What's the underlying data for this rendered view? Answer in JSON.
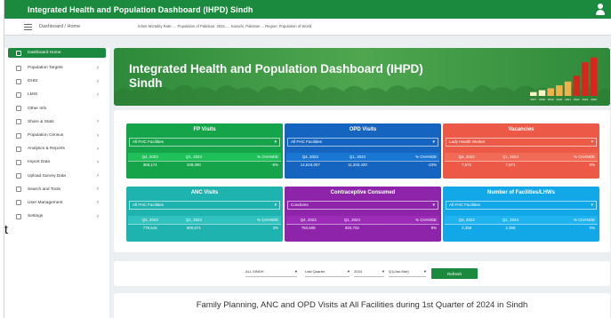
{
  "topbar": {
    "title": "Integrated Health and Population Dashboard (IHPD) Sindh",
    "user_icon": "user-icon"
  },
  "subbar": {
    "breadcrumb": "Dashboard / Home",
    "ticker": "Infant Mortality Rate: ... Population of Pakistan: 2024, ... Karachi, Pakistan ... Region: Population of World"
  },
  "sidebar": {
    "items": [
      {
        "label": "Dashboard Home",
        "icon": "home-icon",
        "caret": ""
      },
      {
        "label": "Population Targets",
        "icon": "target-icon",
        "caret": "›"
      },
      {
        "label": "DHIS",
        "icon": "gear-icon",
        "caret": "›"
      },
      {
        "label": "LMIS",
        "icon": "gear-icon",
        "caret": "›"
      },
      {
        "label": "Other Info",
        "icon": "gear-icon",
        "caret": ""
      },
      {
        "label": "Share & Stats",
        "icon": "gear-icon",
        "caret": "›"
      },
      {
        "label": "Population Census",
        "icon": "gear-icon",
        "caret": "›"
      },
      {
        "label": "Analytics & Reports",
        "icon": "gear-icon",
        "caret": "›"
      },
      {
        "label": "Import Data",
        "icon": "upload-icon",
        "caret": "›"
      },
      {
        "label": "Upload Survey Data",
        "icon": "upload-icon",
        "caret": "›"
      },
      {
        "label": "Search and Tools",
        "icon": "upload-icon",
        "caret": "›"
      },
      {
        "label": "User Management",
        "icon": "users-icon",
        "caret": "›"
      },
      {
        "label": "Settings",
        "icon": "gear-icon",
        "caret": "›"
      }
    ],
    "stray_char": "t"
  },
  "banner": {
    "title": "Integrated Health and Population Dashboard (IHPD) Sindh",
    "mini_chart": {
      "type": "bar",
      "categories": [
        "2017",
        "2018",
        "2019",
        "2020",
        "2021",
        "2022",
        "2023",
        "2024"
      ],
      "values": [
        8,
        12,
        16,
        22,
        30,
        42,
        70,
        80
      ],
      "value_labels": [
        "",
        "",
        "",
        "",
        "",
        "",
        "",
        ""
      ]
    }
  },
  "cards": [
    {
      "title": "FP Visits",
      "color": "#16a44a",
      "header_color": "#1fbf5a",
      "select": "All FHC Facilities",
      "cols": [
        "Q4, 2023",
        "Q1, 2024",
        "% CHANGE"
      ],
      "vals": [
        "369,174",
        "349,390",
        "-5%"
      ]
    },
    {
      "title": "OPD Visits",
      "color": "#1564c0",
      "header_color": "#1976d2",
      "select": "All FHC Facilities",
      "cols": [
        "Q4, 2023",
        "Q1, 2024",
        "% CHANGE"
      ],
      "vals": [
        "14,619,007",
        "11,203,420",
        "-23%"
      ]
    },
    {
      "title": "Vacancies",
      "color": "#ec5a47",
      "header_color": "#f06a55",
      "select": "Lady Health Worker",
      "cols": [
        "Q4, 2023",
        "Q1, 2024",
        "% CHANGE"
      ],
      "vals": [
        "7,571",
        "7,571",
        "0%"
      ]
    },
    {
      "title": "ANC Visits",
      "color": "#1fb3b0",
      "header_color": "#30c2bf",
      "select": "All FHC Facilities",
      "cols": [
        "Q4, 2023",
        "Q1, 2024",
        "% CHANGE"
      ],
      "vals": [
        "775,516",
        "800,671",
        "3%"
      ]
    },
    {
      "title": "Contraceptive Consumed",
      "color": "#8e24aa",
      "header_color": "#9c2bb8",
      "select": "Condoms",
      "cols": [
        "Q4, 2023",
        "Q1, 2024",
        "% CHANGE"
      ],
      "vals": [
        "750,608",
        "820,702",
        "9%"
      ]
    },
    {
      "title": "Number of Facilities/LHWs",
      "color": "#12a7e6",
      "header_color": "#1fb4ef",
      "select": "All FHC Facilities",
      "cols": [
        "Q4, 2023",
        "Q1, 2024",
        "% CHANGE"
      ],
      "vals": [
        "2,358",
        "2,358",
        "0%"
      ]
    }
  ],
  "filters": {
    "selects": [
      "ALL SINDH",
      "Last Quarter",
      "2024",
      "Q1(Jan-Mar)"
    ],
    "refresh_label": "Refresh"
  },
  "bottom": {
    "title": "Family Planning, ANC and OPD Visits at All Facilities during 1st Quarter of 2024 in Sindh"
  }
}
